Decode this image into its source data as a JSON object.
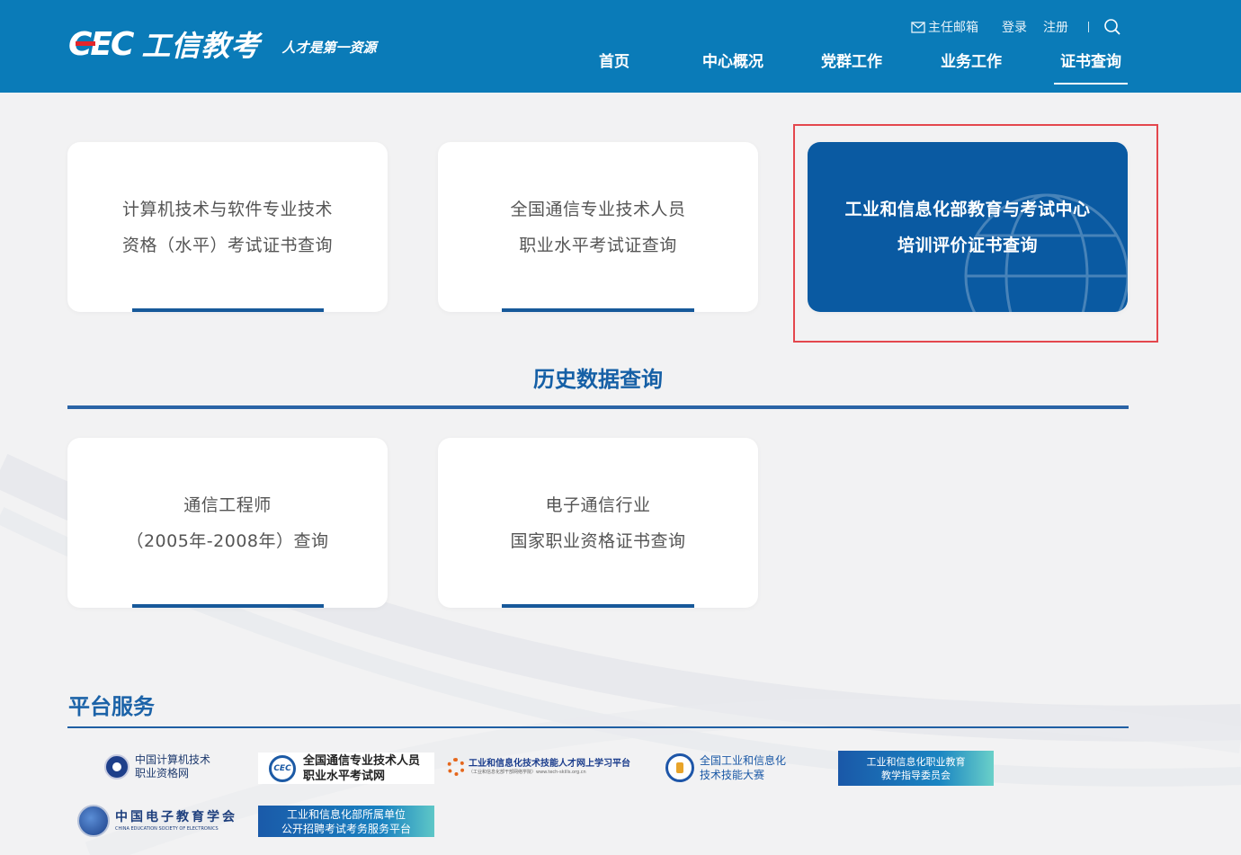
{
  "header": {
    "logo_mark": "CEC",
    "logo_name": "工信教考",
    "slogan": "人才是第一资源",
    "top_links": {
      "mail": "主任邮箱",
      "login": "登录",
      "register": "注册"
    },
    "nav": [
      {
        "label": "首页"
      },
      {
        "label": "中心概况"
      },
      {
        "label": "党群工作"
      },
      {
        "label": "业务工作"
      },
      {
        "label": "证书查询",
        "active": true
      }
    ]
  },
  "cards_primary": [
    {
      "line1": "计算机技术与软件专业技术",
      "line2": "资格（水平）考试证书查询"
    },
    {
      "line1": "全国通信专业技术人员",
      "line2": "职业水平考试证查询"
    },
    {
      "line1": "工业和信息化部教育与考试中心",
      "line2": "培训评价证书查询",
      "highlighted": true
    }
  ],
  "history": {
    "title": "历史数据查询",
    "cards": [
      {
        "line1": "通信工程师",
        "line2": "（2005年-2008年）查询"
      },
      {
        "line1": "电子通信行业",
        "line2": "国家职业资格证书查询"
      }
    ]
  },
  "platform": {
    "title": "平台服务",
    "partners": {
      "ncre": {
        "line1": "中国计算机技术",
        "line2": "职业资格网"
      },
      "telecom": {
        "badge": "CEC",
        "line1": "全国通信专业技术人员",
        "line2": "职业水平考试网"
      },
      "skills": {
        "line1": "工业和信息化技术技能人才网上学习平台",
        "line2": "（工业和信息化部干部网络学院）www.tech-skills.org.cn"
      },
      "contest": {
        "line1": "全国工业和信息化",
        "line2": "技术技能大赛"
      },
      "edu": {
        "line1": "工业和信息化职业教育",
        "line2": "教学指导委员会"
      },
      "cies": {
        "line1": "中国电子教育学会",
        "line2": "CHINA EDUCATION SOCIETY OF ELECTRONICS"
      },
      "recruit": {
        "line1": "工业和信息化部所属单位",
        "line2": "公开招聘考试考务服务平台"
      }
    }
  },
  "colors": {
    "header_bg": "#0a7bb8",
    "card_highlight": "#0a5aa2",
    "accent_line": "#17599a",
    "annotation_box": "#e4474d"
  }
}
